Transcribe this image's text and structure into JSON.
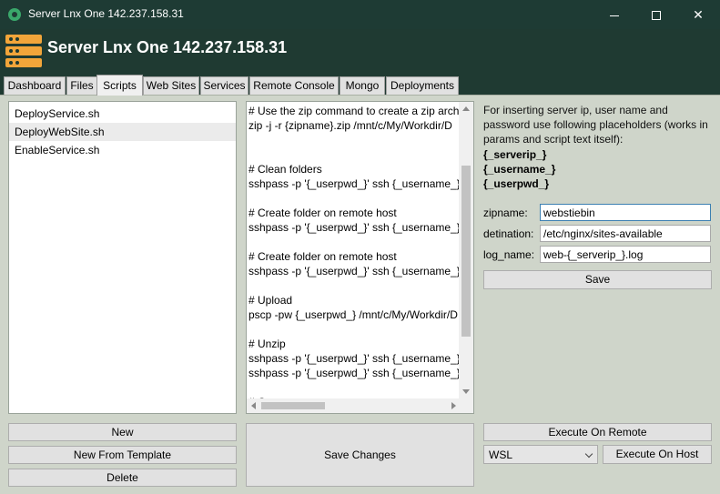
{
  "window": {
    "title": "Server Lnx One 142.237.158.31"
  },
  "header": {
    "title": "Server Lnx One 142.237.158.31"
  },
  "tabs": [
    {
      "label": "Dashboard"
    },
    {
      "label": "Files"
    },
    {
      "label": "Scripts",
      "active": true
    },
    {
      "label": "Web Sites"
    },
    {
      "label": "Services"
    },
    {
      "label": "Remote Console"
    },
    {
      "label": "Mongo"
    },
    {
      "label": "Deployments"
    }
  ],
  "scripts": {
    "items": [
      {
        "label": "DeployService.sh"
      },
      {
        "label": "DeployWebSite.sh",
        "selected": true
      },
      {
        "label": "EnableService.sh"
      }
    ]
  },
  "editor": {
    "lines": [
      "# Use the zip command to create a zip arch",
      "zip -j -r {zipname}.zip /mnt/c/My/Workdir/D",
      "",
      "",
      "# Clean folders",
      "sshpass -p '{_userpwd_}' ssh {_username_}@",
      "",
      "# Create folder on remote host",
      "sshpass -p '{_userpwd_}' ssh {_username_}@",
      "",
      "# Create folder on remote host",
      "sshpass -p '{_userpwd_}' ssh {_username_}@",
      "",
      "# Upload",
      "pscp -pw {_userpwd_} /mnt/c/My/Workdir/D",
      "",
      "# Unzip",
      "sshpass -p '{_userpwd_}' ssh {_username_}@",
      "sshpass -p '{_userpwd_}' ssh {_username_}@",
      "",
      "# C"
    ]
  },
  "info": {
    "text": "For inserting server ip, user name and password use following placeholders (works in params and script text itself):",
    "placeholders": [
      "{_serverip_}",
      "{_username_}",
      "{_userpwd_}"
    ]
  },
  "params": [
    {
      "label": "zipname:",
      "value": "webstiebin"
    },
    {
      "label": "detination:",
      "value": "/etc/nginx/sites-available"
    },
    {
      "label": "log_name:",
      "value": "web-{_serverip_}.log"
    }
  ],
  "buttons": {
    "save": "Save",
    "new": "New",
    "new_from_template": "New From Template",
    "delete": "Delete",
    "save_changes": "Save Changes",
    "execute_on_remote": "Execute On Remote",
    "execute_on_host": "Execute On Host"
  },
  "host_select": {
    "value": "WSL"
  }
}
